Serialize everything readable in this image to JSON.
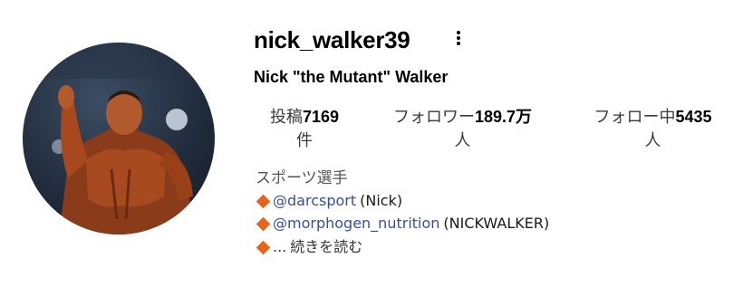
{
  "profile": {
    "username": "nick_walker39",
    "full_name": "Nick \"the Mutant\" Walker",
    "more_icon": "more-vertical-icon",
    "avatar_icon": "profile-photo"
  },
  "stats": {
    "posts": {
      "label": "投稿",
      "value": "7169",
      "unit": "件"
    },
    "followers": {
      "label": "フォロワー",
      "value": "189.7万",
      "unit": "人"
    },
    "following": {
      "label": "フォロー中",
      "value": "5435",
      "unit": "人"
    }
  },
  "bio": {
    "category": "スポーツ選手",
    "lines": [
      {
        "mention": "@darcsport",
        "text": "(Nick)"
      },
      {
        "mention": "@morphogen_nutrition",
        "text": "(NICKWALKER)"
      }
    ],
    "ellipsis": "...",
    "read_more": "続きを読む"
  },
  "colors": {
    "link": "#3b4f93",
    "bullet": "#e8641b",
    "category_text": "#555555"
  }
}
